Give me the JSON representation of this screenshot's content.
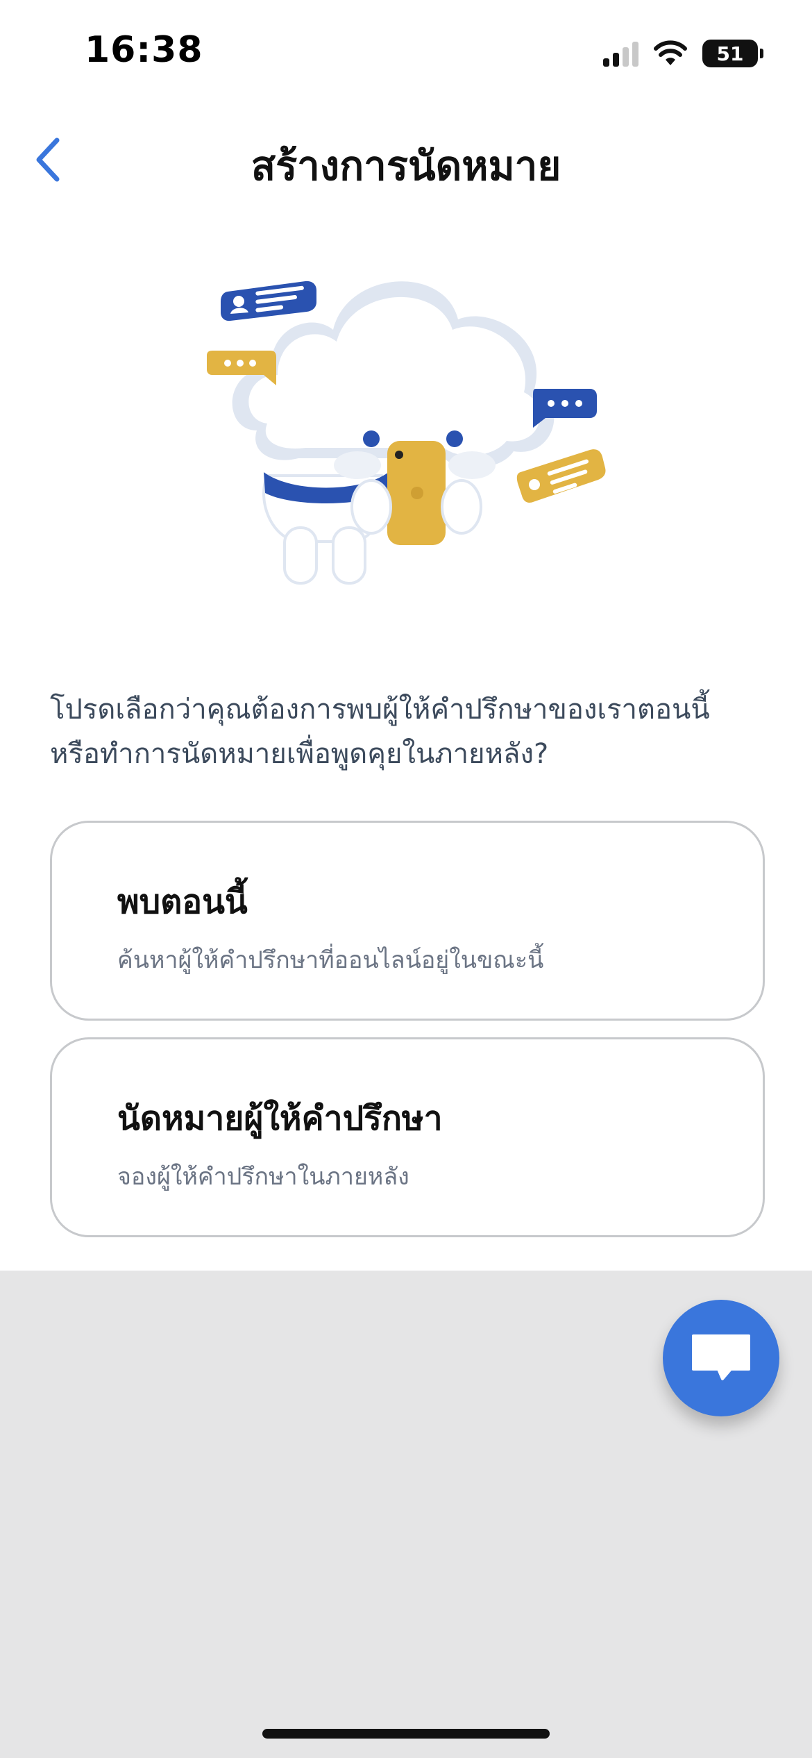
{
  "status_bar": {
    "time": "16:38",
    "battery": "51"
  },
  "header": {
    "title": "สร้างการนัดหมาย"
  },
  "prompt": {
    "line1": "โปรดเลือกว่าคุณต้องการพบผู้ให้คำปรึกษาของเราตอนนี้",
    "line2": "หรือทำการนัดหมายเพื่อพูดคุยในภายหลัง?"
  },
  "options": [
    {
      "title": "พบตอนนี้",
      "subtitle": "ค้นหาผู้ให้คำปรึกษาที่ออนไลน์อยู่ในขณะนี้"
    },
    {
      "title": "นัดหมายผู้ให้คำปรึกษา",
      "subtitle": "จองผู้ให้คำปรึกษาในภายหลัง"
    }
  ],
  "colors": {
    "accent_blue": "#3a76dc",
    "dark_blue": "#2a52b0",
    "yellow": "#e2b443",
    "grey_bg": "#e5e5e6"
  },
  "icons": {
    "back": "chevron-left-icon",
    "chat": "chat-bubble-icon"
  }
}
